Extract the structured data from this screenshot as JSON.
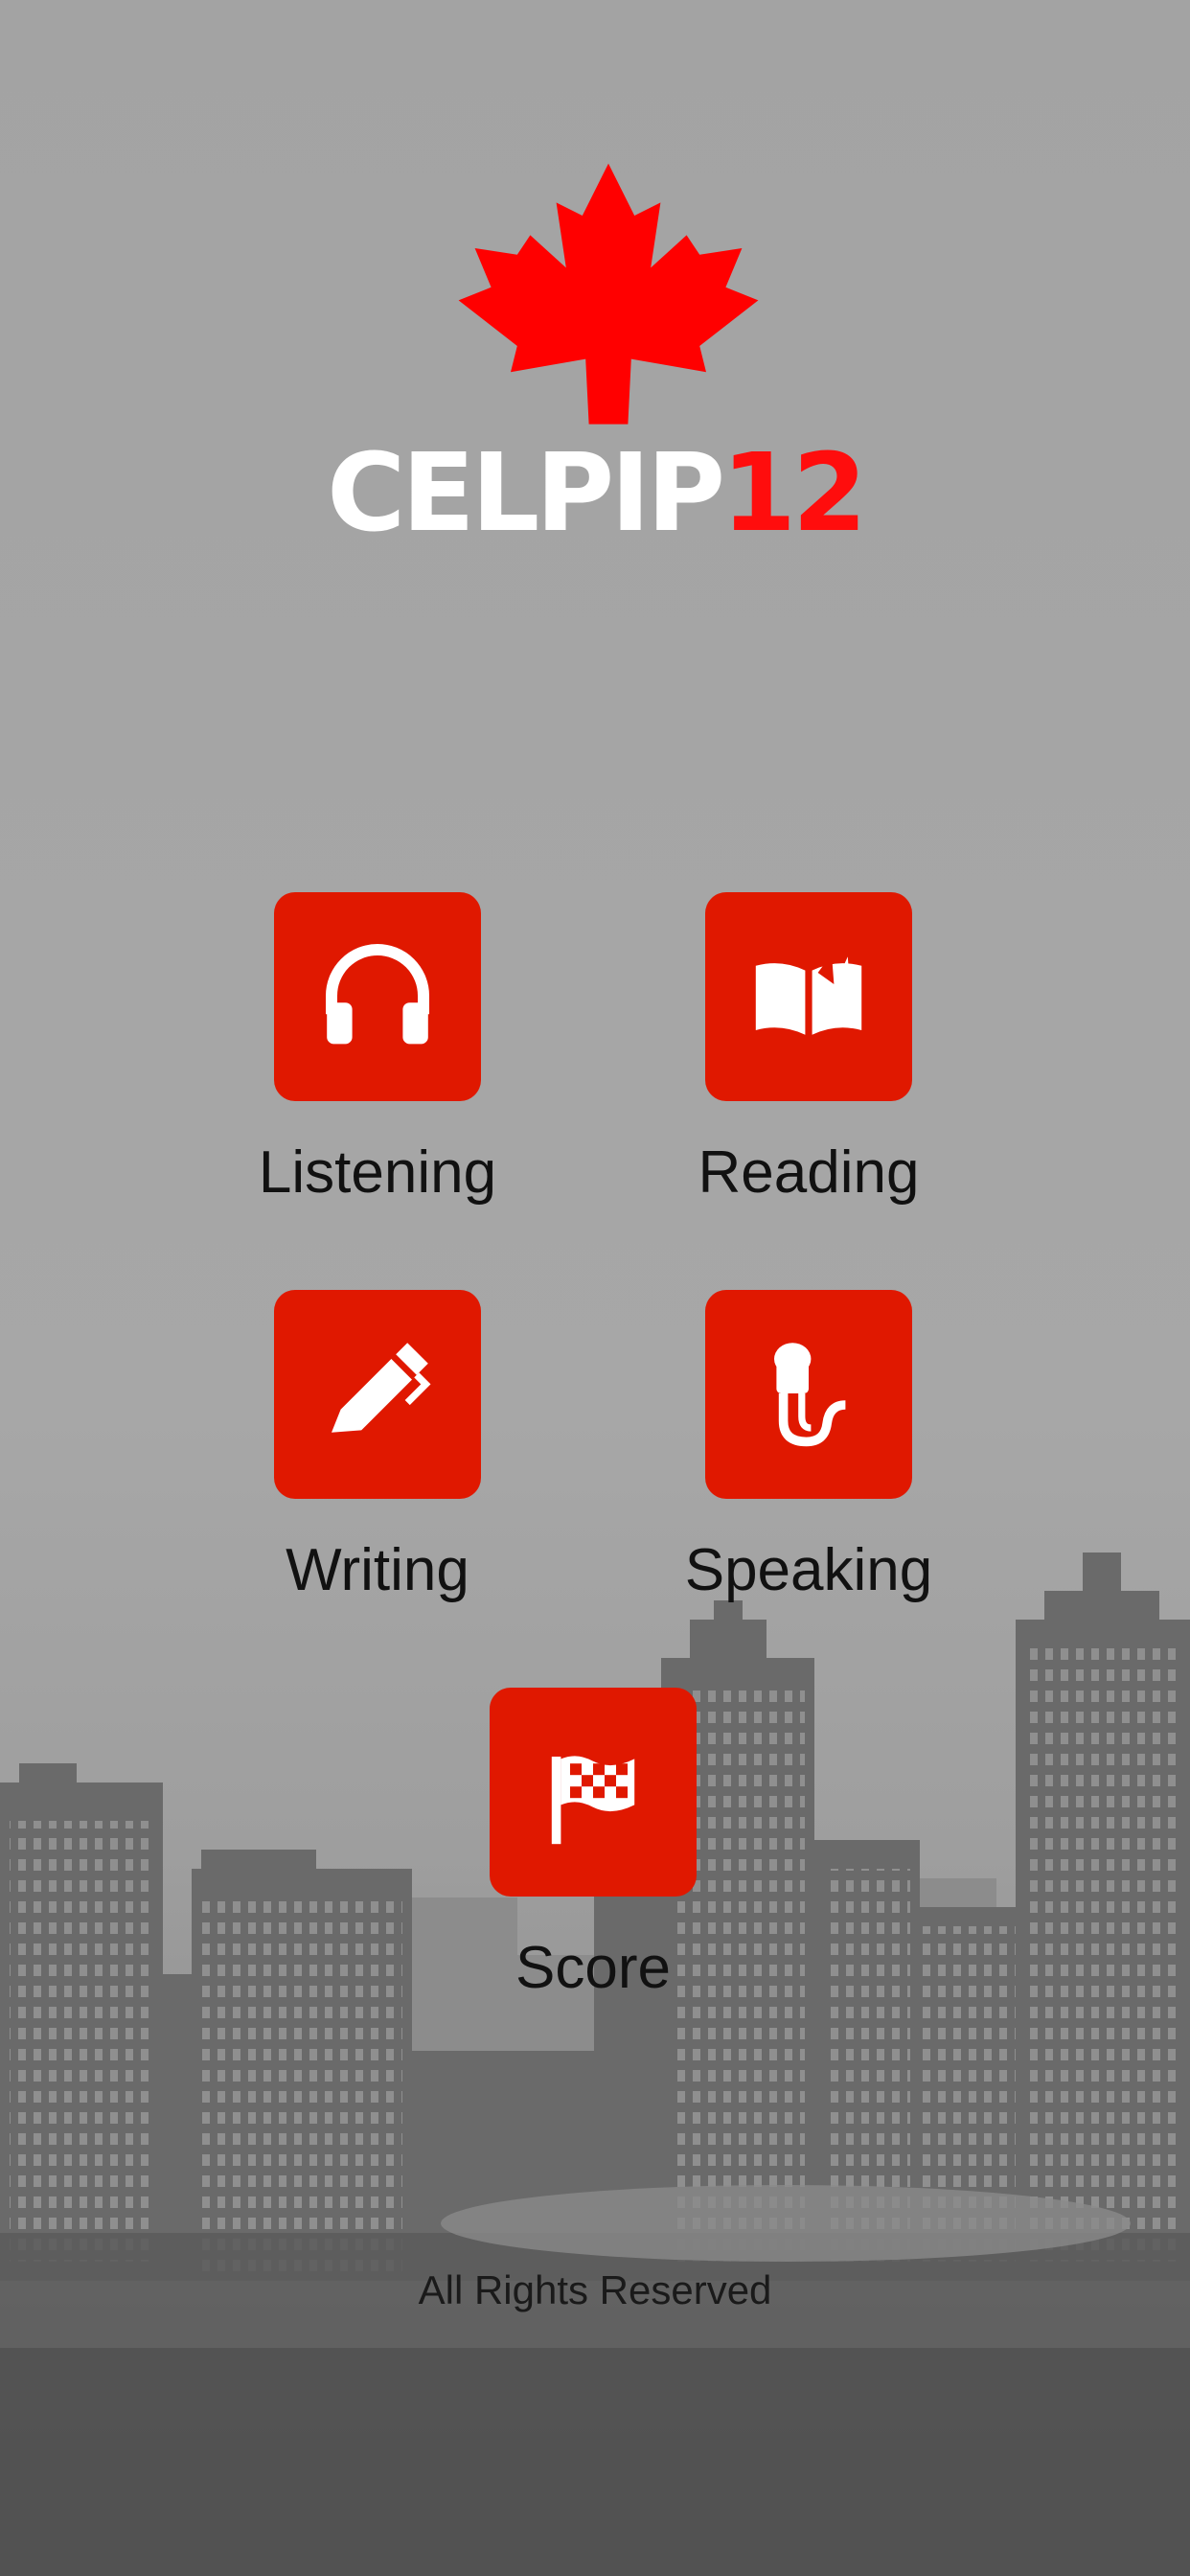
{
  "colors": {
    "tile_red": "#e01800",
    "logo_red": "#ff0d0d",
    "logo_white": "#ffffff",
    "label_text": "#111111"
  },
  "logo": {
    "word": "CELPIP",
    "number": "12",
    "emblem": "maple-leaf-icon"
  },
  "menu": {
    "listening": {
      "label": "Listening",
      "icon": "headphones-icon"
    },
    "reading": {
      "label": "Reading",
      "icon": "open-book-icon"
    },
    "writing": {
      "label": "Writing",
      "icon": "pen-icon"
    },
    "speaking": {
      "label": "Speaking",
      "icon": "microphone-icon"
    },
    "score": {
      "label": "Score",
      "icon": "checkered-flag-icon"
    }
  },
  "footer": {
    "text": "All Rights Reserved"
  }
}
